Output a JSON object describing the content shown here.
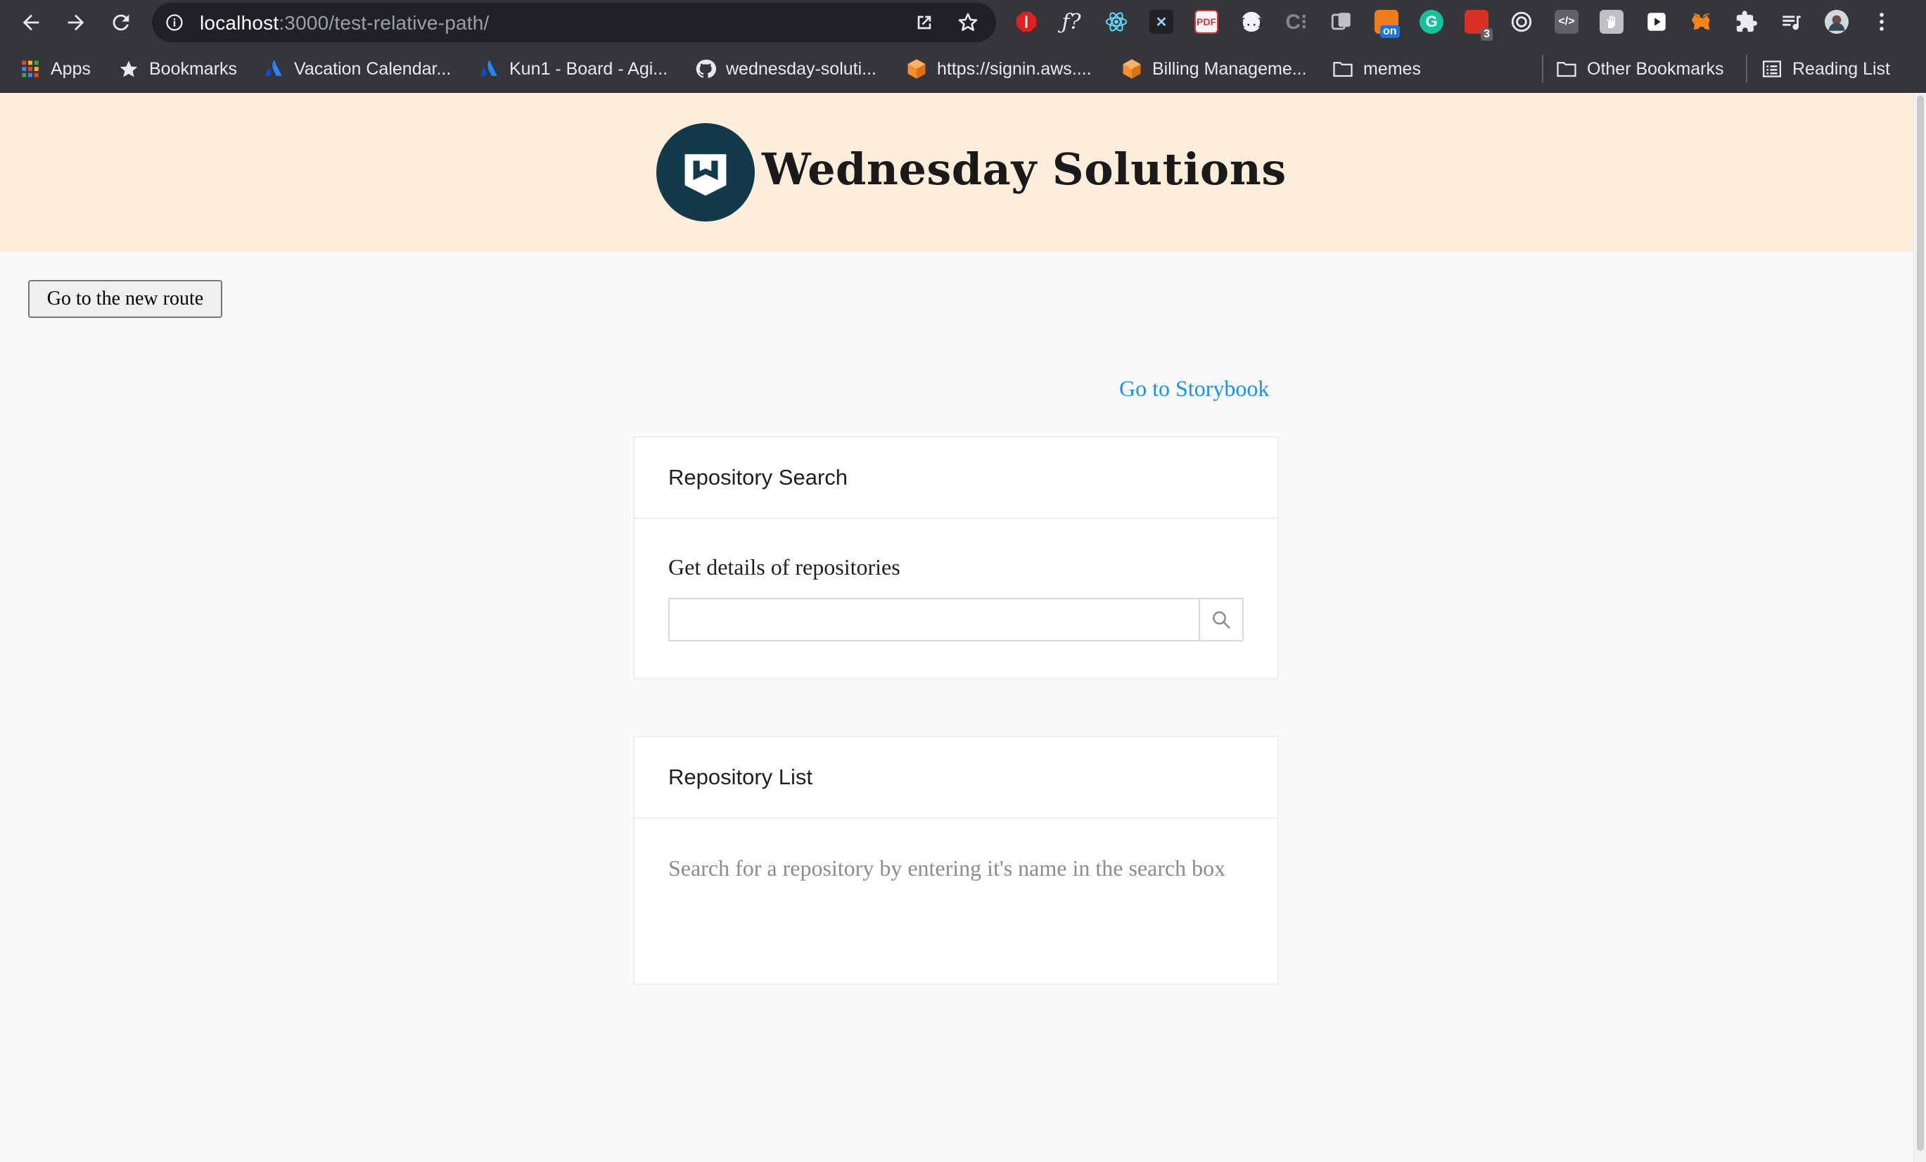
{
  "browser": {
    "url_host": "localhost",
    "url_path": ":3000/test-relative-path/",
    "extension_badges": {
      "on_badge": "on",
      "count_badge": "3"
    },
    "bookmarks": [
      {
        "label": "Apps",
        "icon": "apps-grid-icon"
      },
      {
        "label": "Bookmarks",
        "icon": "star-icon"
      },
      {
        "label": "Vacation Calendar...",
        "icon": "atlassian-icon"
      },
      {
        "label": "Kun1 - Board - Agi...",
        "icon": "atlassian-icon"
      },
      {
        "label": "wednesday-soluti...",
        "icon": "github-icon"
      },
      {
        "label": "https://signin.aws....",
        "icon": "aws-cube-icon"
      },
      {
        "label": "Billing Manageme...",
        "icon": "aws-cube-icon"
      },
      {
        "label": "memes",
        "icon": "folder-icon"
      },
      {
        "label": "Other Bookmarks",
        "icon": "folder-icon"
      },
      {
        "label": "Reading List",
        "icon": "reading-list-icon"
      }
    ]
  },
  "header": {
    "brand_title": "Wednesday Solutions",
    "logo_icon": "wednesday-logo-icon"
  },
  "main": {
    "route_button_label": "Go to the new route",
    "storybook_link": "Go to Storybook",
    "search_card": {
      "title": "Repository Search",
      "label": "Get details of repositories",
      "input_value": "",
      "search_icon": "search-icon"
    },
    "list_card": {
      "title": "Repository List",
      "hint": "Search for a repository by entering it's name in the search box"
    }
  },
  "colors": {
    "header_bg": "#fdeedc",
    "logo_bg": "#123a4b",
    "link": "#1890ff",
    "chrome_bg": "#35363a"
  }
}
